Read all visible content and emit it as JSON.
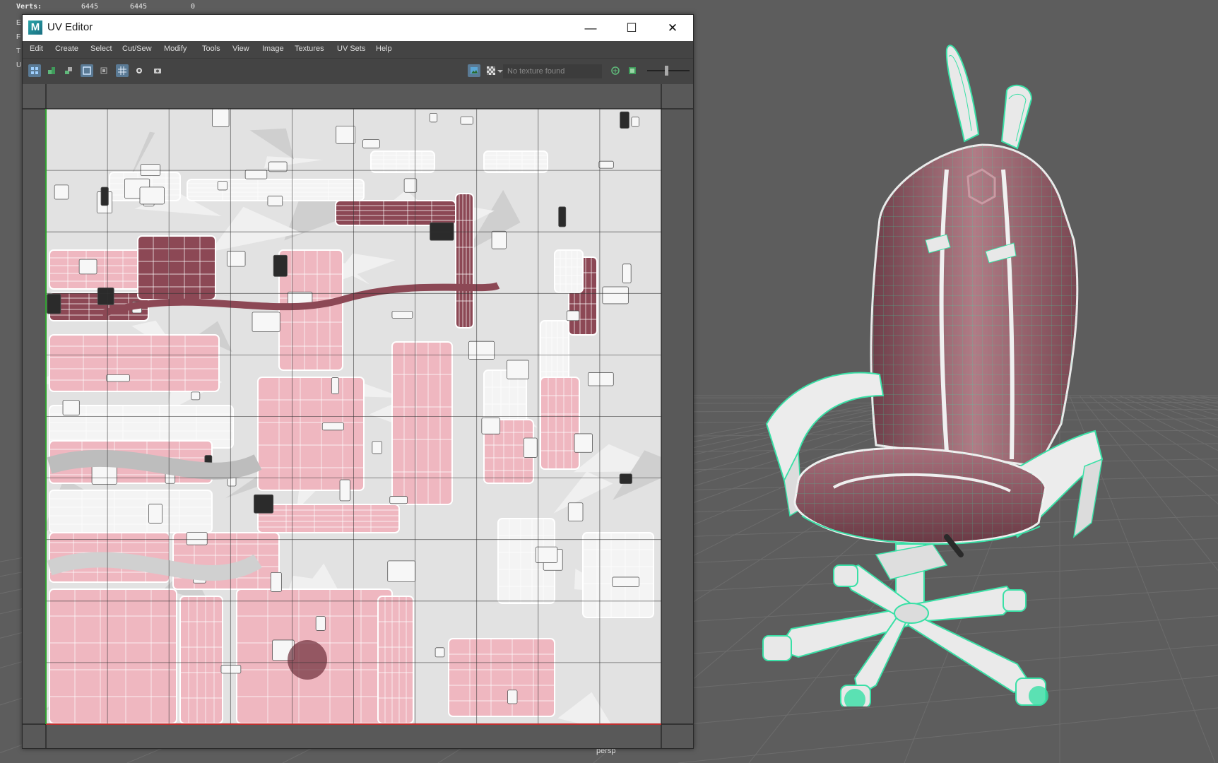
{
  "hud": {
    "verts_label": "Verts:",
    "verts_values": [
      "6445",
      "6445",
      "0"
    ],
    "side_letters": [
      "E",
      "F",
      "T",
      "U"
    ]
  },
  "viewport": {
    "camera_label": "persp"
  },
  "uv_editor": {
    "title": "UV Editor",
    "window_controls": {
      "minimize": "—",
      "maximize": "☐",
      "close": "✕"
    },
    "menu": [
      "Edit",
      "Create",
      "Select",
      "Cut/Sew",
      "Modify",
      "Tools",
      "View",
      "Image",
      "Textures",
      "UV Sets",
      "Help"
    ],
    "texture_field": "No texture found",
    "exposure_slider_fraction": 0.45,
    "icons": [
      "uv-shell-icon",
      "uv-layout-icon",
      "uv-snapshot-icon",
      "frame-all-icon",
      "frame-selected-icon",
      "grid-icon",
      "pixel-snap-icon",
      "camera-icon",
      "image-display-icon",
      "checker-icon",
      "dropdown-icon",
      "refresh-icon",
      "image-icon"
    ]
  },
  "colors": {
    "uv_pink": "#efb7c0",
    "uv_maroon": "#8c4855",
    "uv_white": "#f4f4f4",
    "wire_green": "#39e0a6",
    "seat_surface": "#8a5560",
    "viewport_bg": "#5d5d5d"
  }
}
